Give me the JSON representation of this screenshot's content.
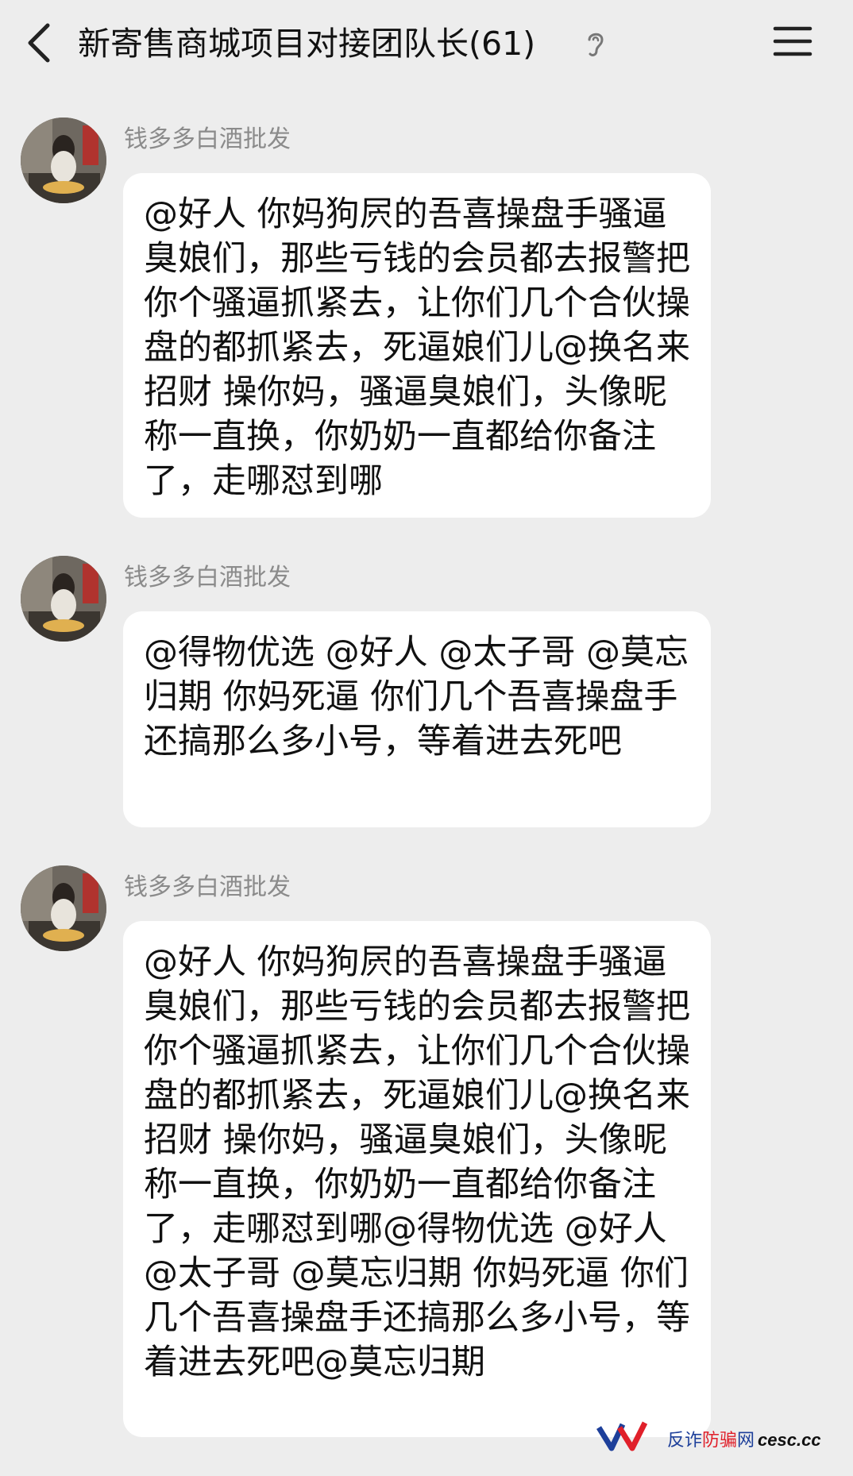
{
  "header": {
    "title": "新寄售商城项目对接团队长(61)"
  },
  "messages": [
    {
      "sender": "钱多多白酒批发",
      "text": "@好人  你妈狗屄的吾喜操盘手骚逼臭娘们，那些亏钱的会员都去报警把你个骚逼抓紧去，让你们几个合伙操盘的都抓紧去，死逼娘们儿@换名来招财 操你妈，骚逼臭娘们，头像昵称一直换，你奶奶一直都给你备注了，走哪怼到哪"
    },
    {
      "sender": "钱多多白酒批发",
      "text": "@得物优选  @好人 @太子哥 @莫忘归期 你妈死逼 你们几个吾喜操盘手还搞那么多小号，等着进去死吧"
    },
    {
      "sender": "钱多多白酒批发",
      "text": "@好人  你妈狗屄的吾喜操盘手骚逼臭娘们，那些亏钱的会员都去报警把你个骚逼抓紧去，让你们几个合伙操盘的都抓紧去，死逼娘们儿@换名来招财 操你妈，骚逼臭娘们，头像昵称一直换，你奶奶一直都给你备注了，走哪怼到哪@得物优选  @好人 @太子哥 @莫忘归期 你妈死逼 你们几个吾喜操盘手还搞那么多小号，等着进去死吧@莫忘归期"
    }
  ],
  "watermark": {
    "text_1": "反诈",
    "text_2": "防骗",
    "text_3": "网",
    "text_4": "cesc.cc"
  },
  "icons": {
    "back": "chevron-left-icon",
    "ear": "ear-icon",
    "menu": "hamburger-menu-icon",
    "avatar": "avatar-image",
    "logo": "anti-fraud-logo"
  },
  "colors": {
    "background": "#ededed",
    "bubble": "#ffffff",
    "sender": "#8b8b8b",
    "text": "#111111",
    "watermark_red": "#e0202a",
    "watermark_blue": "#1d3f9a"
  }
}
